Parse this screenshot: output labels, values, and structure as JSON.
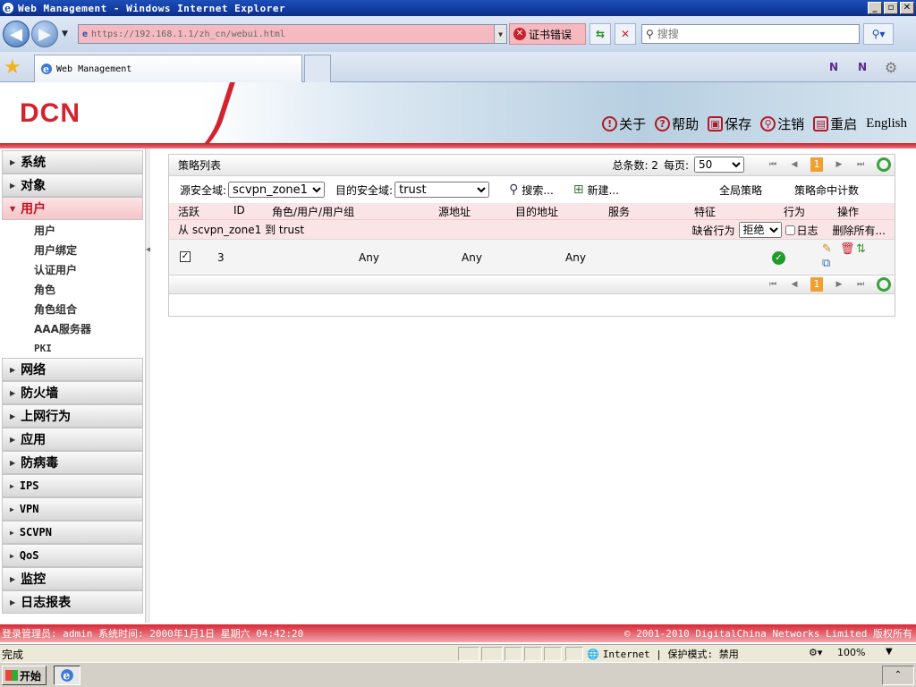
{
  "window": {
    "title": "Web Management - Windows Internet Explorer",
    "min": "_",
    "max": "▫",
    "close": "✕"
  },
  "address": {
    "url": "https://192.168.1.1/zh_cn/webui.html",
    "cert_error": "证书错误",
    "search_placeholder": "搜搜"
  },
  "tab": {
    "title": "Web Management"
  },
  "header": {
    "logo": "DCN",
    "links": [
      {
        "icon": "!",
        "label": "关于"
      },
      {
        "icon": "?",
        "label": "帮助"
      },
      {
        "icon": "▣",
        "label": "保存"
      },
      {
        "icon": "⚲",
        "label": "注销"
      },
      {
        "icon": "▤",
        "label": "重启"
      }
    ],
    "english": "English"
  },
  "sidebar": {
    "items": [
      {
        "label": "系统"
      },
      {
        "label": "对象"
      },
      {
        "label": "用户"
      },
      {
        "label": "网络"
      },
      {
        "label": "防火墙"
      },
      {
        "label": "上网行为"
      },
      {
        "label": "应用"
      },
      {
        "label": "防病毒"
      },
      {
        "label": "IPS"
      },
      {
        "label": "VPN"
      },
      {
        "label": "SCVPN"
      },
      {
        "label": "QoS"
      },
      {
        "label": "监控"
      },
      {
        "label": "日志报表"
      }
    ],
    "subitems": [
      "用户",
      "用户绑定",
      "认证用户",
      "角色",
      "角色组合",
      "AAA服务器",
      "PKI"
    ]
  },
  "panel": {
    "title": "策略列表",
    "total_label": "总条数: 2",
    "per_page_label": "每页:",
    "per_page_value": "50",
    "current_page": "1",
    "source_zone_label": "源安全域:",
    "source_zone_value": "scvpn_zone1",
    "dest_zone_label": "目的安全域:",
    "dest_zone_value": "trust",
    "search_label": "搜索...",
    "new_label": "新建...",
    "global_policy": "全局策略",
    "hit_count": "策略命中计数",
    "columns": {
      "active": "活跃",
      "id": "ID",
      "role": "角色/用户/用户组",
      "src": "源地址",
      "dst": "目的地址",
      "service": "服务",
      "feature": "特征",
      "action": "行为",
      "ops": "操作"
    },
    "zone_row": {
      "text": "从 scvpn_zone1 到 trust",
      "default_action_label": "缺省行为",
      "default_action_value": "拒绝",
      "log_label": "日志",
      "delete_all": "删除所有..."
    },
    "rows": [
      {
        "active": "✓",
        "id": "3",
        "role": "Any",
        "src": "Any",
        "dst": "Any"
      }
    ]
  },
  "footer": {
    "left": "登录管理员: admin 系统时间: 2000年1月1日 星期六 04:42:20",
    "right": "© 2001-2010 DigitalChina Networks Limited 版权所有"
  },
  "ie_status": {
    "done": "完成",
    "zone": "Internet | 保护模式: 禁用",
    "zoom": "100%"
  },
  "taskbar": {
    "start": "开始"
  },
  "colors": {
    "brand_red": "#d4232e",
    "row_pink": "#fbe4e6",
    "page_orange": "#f0a030"
  }
}
